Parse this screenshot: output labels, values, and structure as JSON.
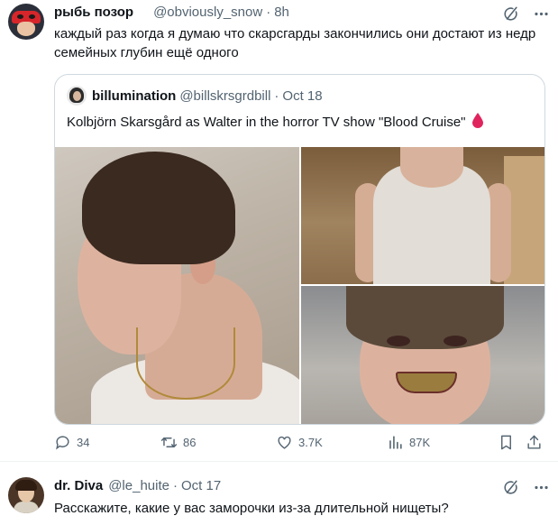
{
  "main_tweet": {
    "display_name": "рыбь позор",
    "handle": "@obviously_snow",
    "time": "8h",
    "text": "каждый раз когда я думаю что скарсгарды закончились они достают из недр семейных глубин ещё одного",
    "quote": {
      "display_name": "billumination",
      "handle": "@billskrsgrdbill",
      "time": "Oct 18",
      "text": "Kolbjörn Skarsgård as Walter in the horror TV show \"Blood Cruise\"",
      "emoji": "blood-drop"
    },
    "actions": {
      "replies": "34",
      "retweets": "86",
      "likes": "3.7K",
      "views": "87K"
    }
  },
  "reply_tweet": {
    "display_name": "dr. Diva",
    "handle": "@le_huite",
    "time": "Oct 17",
    "text": "Расскажите, какие у вас заморочки из-за длительной нищеты?"
  },
  "colors": {
    "text_primary": "#0f1419",
    "text_secondary": "#536471",
    "border": "#cfd9de",
    "blood_red": "#e0245e"
  }
}
